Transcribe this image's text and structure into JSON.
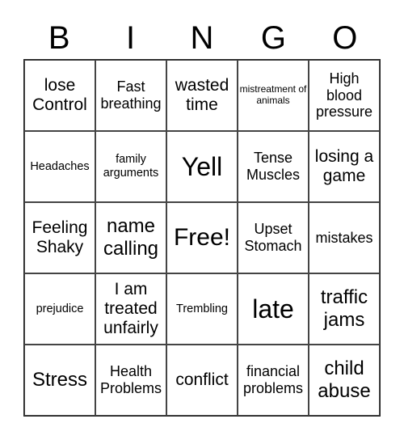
{
  "header": {
    "letters": [
      "B",
      "I",
      "N",
      "G",
      "O"
    ]
  },
  "cells": [
    {
      "text": "lose Control",
      "size": "l"
    },
    {
      "text": "Fast breathing",
      "size": "m"
    },
    {
      "text": "wasted time",
      "size": "l"
    },
    {
      "text": "mistreatment of animals",
      "size": "xs"
    },
    {
      "text": "High blood pressure",
      "size": "m"
    },
    {
      "text": "Headaches",
      "size": "s"
    },
    {
      "text": "family arguments",
      "size": "s"
    },
    {
      "text": "Yell",
      "size": "xxl"
    },
    {
      "text": "Tense Muscles",
      "size": "m"
    },
    {
      "text": "losing a game",
      "size": "l"
    },
    {
      "text": "Feeling Shaky",
      "size": "l"
    },
    {
      "text": "name calling",
      "size": "xl"
    },
    {
      "text": "Free!",
      "size": "free"
    },
    {
      "text": "Upset Stomach",
      "size": "m"
    },
    {
      "text": "mistakes",
      "size": "m"
    },
    {
      "text": "prejudice",
      "size": "s"
    },
    {
      "text": "I am treated unfairly",
      "size": "l"
    },
    {
      "text": "Trembling",
      "size": "s"
    },
    {
      "text": "late",
      "size": "xxl"
    },
    {
      "text": "traffic jams",
      "size": "xl"
    },
    {
      "text": "Stress",
      "size": "xl"
    },
    {
      "text": "Health Problems",
      "size": "m"
    },
    {
      "text": "conflict",
      "size": "l"
    },
    {
      "text": "financial problems",
      "size": "m"
    },
    {
      "text": "child abuse",
      "size": "xl"
    }
  ]
}
